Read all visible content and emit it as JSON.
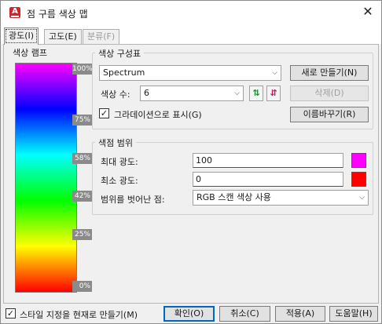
{
  "window": {
    "title": "점 구름 색상 맵",
    "app_icon_letter": "A"
  },
  "tabs": [
    {
      "label": "광도(I)",
      "active": true
    },
    {
      "label": "고도(E)",
      "active": false
    },
    {
      "label": "분류(F)",
      "active": false,
      "disabled": true
    }
  ],
  "ramp": {
    "title": "색상 램프",
    "ticks": [
      "100%",
      "75%",
      "58%",
      "42%",
      "25%",
      "0%"
    ]
  },
  "scheme": {
    "title": "색상 구성표",
    "selected": "Spectrum",
    "new_button": "새로 만들기(N)",
    "count_label": "색상 수:",
    "count_value": "6",
    "delete_button": "삭제(D)",
    "gradient_label": "그라데이션으로 표시(G)",
    "gradient_checked": true,
    "rename_button": "이름바꾸기(R)"
  },
  "range": {
    "title": "색점 범위",
    "max_label": "최대 광도:",
    "max_value": "100",
    "max_color": "#ff00ff",
    "min_label": "최소 광도:",
    "min_value": "0",
    "min_color": "#ff0000",
    "out_label": "범위를 벗어난 점:",
    "out_value": "RGB 스캔 색상 사용"
  },
  "footer": {
    "style_label": "스타일 지정을 현재로 만들기(M)",
    "style_checked": true,
    "ok": "확인(O)",
    "cancel": "취소(C)",
    "apply": "적용(A)",
    "help": "도움말(H)"
  }
}
